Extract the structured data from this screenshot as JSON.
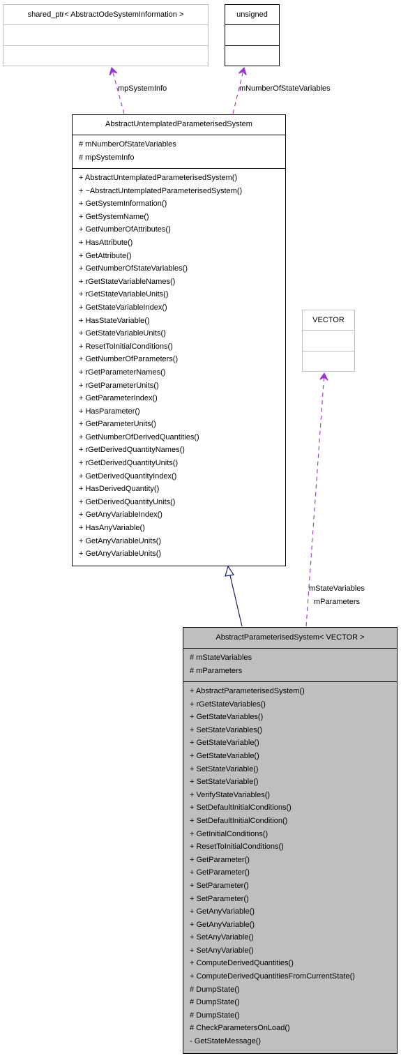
{
  "diagram": {
    "type": "uml-class-collaboration",
    "colors": {
      "composition_edge": "#9a32cd",
      "inheritance_edge": "#191970",
      "focus_fill": "#bfbfbf",
      "ghost_border": "#c0c0c0"
    },
    "classes": {
      "shared_ptr": {
        "name": "shared_ptr< AbstractOdeSystemInformation >",
        "attributes": [],
        "methods": []
      },
      "unsigned": {
        "name": "unsigned",
        "attributes": [],
        "methods": []
      },
      "vector": {
        "name": "VECTOR",
        "attributes": [],
        "methods": []
      },
      "untemplated": {
        "name": "AbstractUntemplatedParameterisedSystem",
        "attributes": [
          "# mNumberOfStateVariables",
          "# mpSystemInfo"
        ],
        "methods": [
          "+ AbstractUntemplatedParameterisedSystem()",
          "+ ~AbstractUntemplatedParameterisedSystem()",
          "+ GetSystemInformation()",
          "+ GetSystemName()",
          "+ GetNumberOfAttributes()",
          "+ HasAttribute()",
          "+ GetAttribute()",
          "+ GetNumberOfStateVariables()",
          "+ rGetStateVariableNames()",
          "+ rGetStateVariableUnits()",
          "+ GetStateVariableIndex()",
          "+ HasStateVariable()",
          "+ GetStateVariableUnits()",
          "+ ResetToInitialConditions()",
          "+ GetNumberOfParameters()",
          "+ rGetParameterNames()",
          "+ rGetParameterUnits()",
          "+ GetParameterIndex()",
          "+ HasParameter()",
          "+ GetParameterUnits()",
          "+ GetNumberOfDerivedQuantities()",
          "+ rGetDerivedQuantityNames()",
          "+ rGetDerivedQuantityUnits()",
          "+ GetDerivedQuantityIndex()",
          "+ HasDerivedQuantity()",
          "+ GetDerivedQuantityUnits()",
          "+ GetAnyVariableIndex()",
          "+ HasAnyVariable()",
          "+ GetAnyVariableUnits()",
          "+ GetAnyVariableUnits()"
        ]
      },
      "parameterised": {
        "name": "AbstractParameterisedSystem< VECTOR >",
        "attributes": [
          "# mStateVariables",
          "# mParameters"
        ],
        "methods": [
          "+ AbstractParameterisedSystem()",
          "+ rGetStateVariables()",
          "+ GetStateVariables()",
          "+ SetStateVariables()",
          "+ GetStateVariable()",
          "+ GetStateVariable()",
          "+ SetStateVariable()",
          "+ SetStateVariable()",
          "+ VerifyStateVariables()",
          "+ SetDefaultInitialConditions()",
          "+ SetDefaultInitialCondition()",
          "+ GetInitialConditions()",
          "+ ResetToInitialConditions()",
          "+ GetParameter()",
          "+ GetParameter()",
          "+ SetParameter()",
          "+ SetParameter()",
          "+ GetAnyVariable()",
          "+ GetAnyVariable()",
          "+ SetAnyVariable()",
          "+ SetAnyVariable()",
          "+ ComputeDerivedQuantities()",
          "+ ComputeDerivedQuantitiesFromCurrentState()",
          "# DumpState()",
          "# DumpState()",
          "# DumpState()",
          "# CheckParametersOnLoad()",
          "- GetStateMessage()"
        ]
      }
    },
    "edges": [
      {
        "from": "untemplated",
        "to": "shared_ptr",
        "kind": "composition",
        "label": "mpSystemInfo"
      },
      {
        "from": "untemplated",
        "to": "unsigned",
        "kind": "composition",
        "label": "mNumberOfStateVariables"
      },
      {
        "from": "parameterised",
        "to": "untemplated",
        "kind": "inheritance",
        "label": ""
      },
      {
        "from": "parameterised",
        "to": "vector",
        "kind": "composition",
        "label_lines": [
          "mStateVariables",
          "mParameters"
        ]
      }
    ]
  }
}
